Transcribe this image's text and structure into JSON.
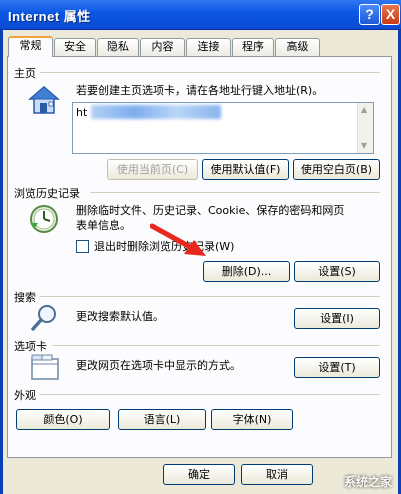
{
  "window": {
    "title": "Internet 属性",
    "help_label": "?",
    "close_label": "X"
  },
  "tabs": [
    {
      "label": "常规",
      "active": true
    },
    {
      "label": "安全"
    },
    {
      "label": "隐私"
    },
    {
      "label": "内容"
    },
    {
      "label": "连接"
    },
    {
      "label": "程序"
    },
    {
      "label": "高级"
    }
  ],
  "home": {
    "section_label": "主页",
    "description": "若要创建主页选项卡，请在各地址行键入地址(R)。",
    "url_value": "ht",
    "use_current_label": "使用当前页(C)",
    "use_default_label": "使用默认值(F)",
    "use_blank_label": "使用空白页(B)"
  },
  "history": {
    "section_label": "浏览历史记录",
    "description_line1": "删除临时文件、历史记录、Cookie、保存的密码和网页",
    "description_line2": "表单信息。",
    "checkbox_label": "退出时删除浏览历史记录(W)",
    "delete_label": "删除(D)...",
    "settings_label": "设置(S)"
  },
  "search": {
    "section_label": "搜索",
    "description": "更改搜索默认值。",
    "settings_label": "设置(I)"
  },
  "tabs_section": {
    "section_label": "选项卡",
    "description": "更改网页在选项卡中显示的方式。",
    "settings_label": "设置(T)"
  },
  "appearance": {
    "section_label": "外观",
    "colors_label": "颜色(O)",
    "languages_label": "语言(L)",
    "fonts_label": "字体(N)"
  },
  "footer": {
    "ok_label": "确定",
    "cancel_label": "取消",
    "watermark": "系统之家"
  },
  "colors": {
    "accent_red": "#e8271d",
    "title_blue": "#0b57e2",
    "tab_highlight": "#f1a33b"
  }
}
